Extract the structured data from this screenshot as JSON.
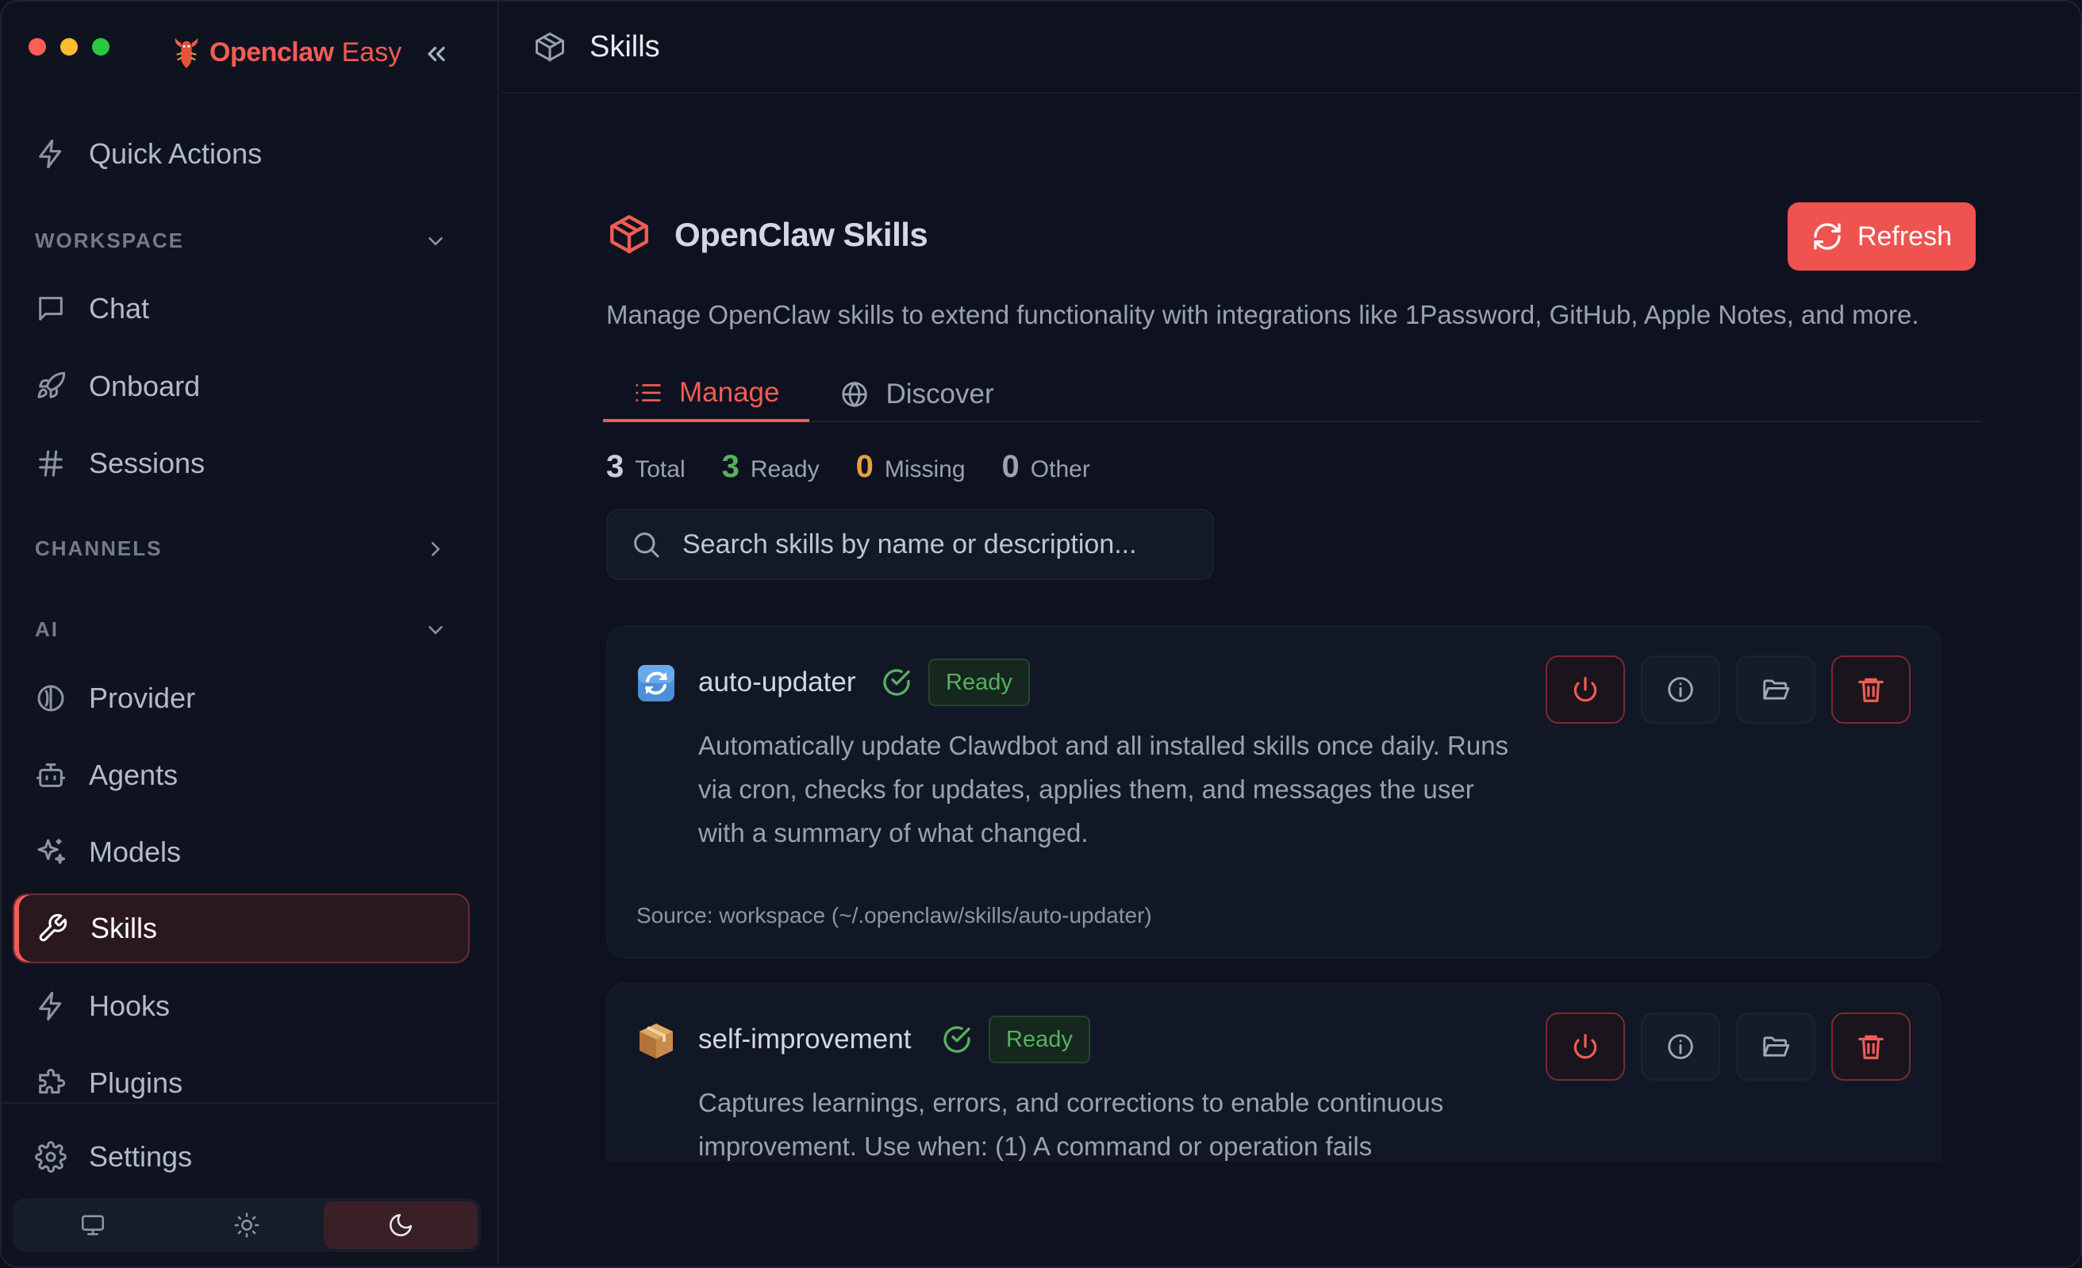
{
  "app": {
    "brand_name": "Openclaw",
    "brand_suffix": "Easy"
  },
  "topbar": {
    "title": "Skills"
  },
  "sidebar": {
    "quick_actions": "Quick Actions",
    "sections": {
      "workspace": "WORKSPACE",
      "channels": "CHANNELS",
      "ai": "AI"
    },
    "items": {
      "chat": "Chat",
      "onboard": "Onboard",
      "sessions": "Sessions",
      "provider": "Provider",
      "agents": "Agents",
      "models": "Models",
      "skills": "Skills",
      "hooks": "Hooks",
      "plugins": "Plugins",
      "settings": "Settings"
    },
    "active_item": "skills",
    "theme_active": "dark"
  },
  "main": {
    "title": "OpenClaw Skills",
    "refresh_label": "Refresh",
    "description": "Manage OpenClaw skills to extend functionality with integrations like 1Password, GitHub, Apple Notes, and more.",
    "tabs": [
      {
        "label": "Manage",
        "icon": "list-icon",
        "active": true
      },
      {
        "label": "Discover",
        "icon": "globe-icon",
        "active": false
      }
    ],
    "stats": {
      "total": {
        "value": "3",
        "label": "Total"
      },
      "ready": {
        "value": "3",
        "label": "Ready"
      },
      "missing": {
        "value": "0",
        "label": "Missing"
      },
      "other": {
        "value": "0",
        "label": "Other"
      }
    },
    "search": {
      "placeholder": "Search skills by name or description..."
    },
    "skills": [
      {
        "name": "auto-updater",
        "icon": "arrows-refresh-emoji",
        "status": "Ready",
        "description": "Automatically update Clawdbot and all installed skills once daily. Runs via cron, checks for updates, applies them, and messages the user with a summary of what changed.",
        "source": "Source: workspace (~/.openclaw/skills/auto-updater)"
      },
      {
        "name": "self-improvement",
        "icon": "package-emoji",
        "status": "Ready",
        "description": "Captures learnings, errors, and corrections to enable continuous improvement. Use when: (1) A command or operation fails"
      }
    ]
  },
  "colors": {
    "accent": "#f25c54",
    "ready_green": "#58b05e",
    "missing_orange": "#e6a23c",
    "background": "#0e1220"
  }
}
